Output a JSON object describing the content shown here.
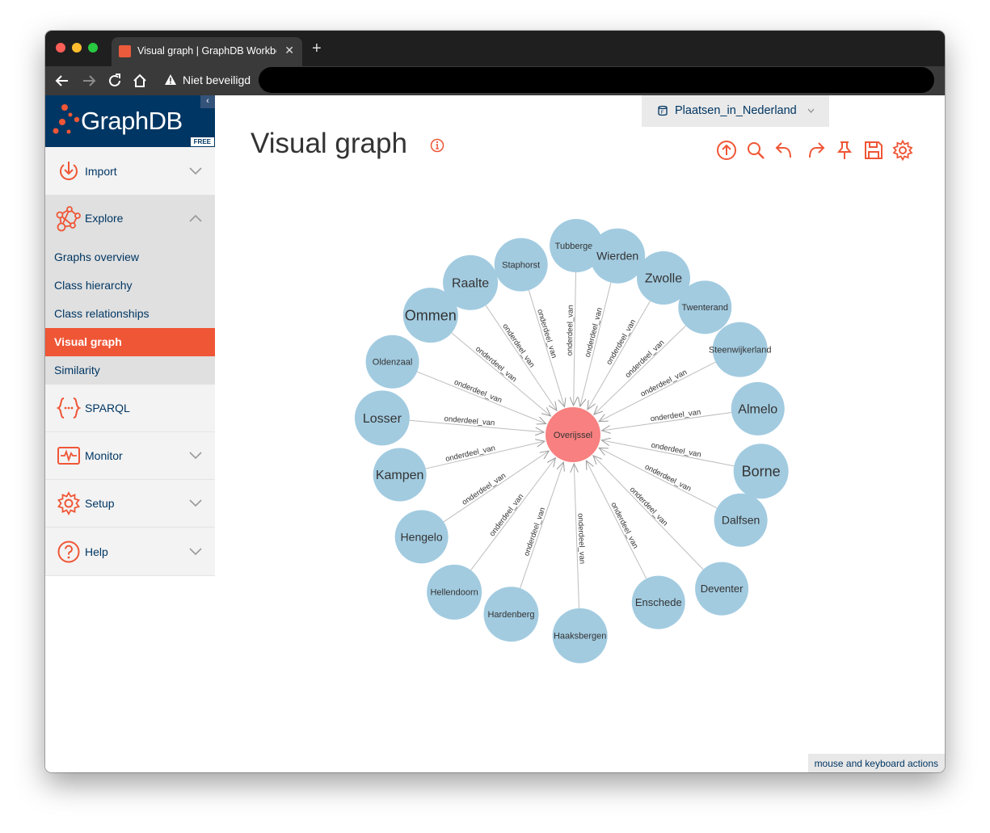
{
  "browser": {
    "tab_title": "Visual graph | GraphDB Workbench",
    "security_label": "Niet beveiligd",
    "url": ""
  },
  "sidebar": {
    "logo_text": "GraphDB",
    "edition_badge": "FREE",
    "collapse_glyph": "‹",
    "items": [
      {
        "label": "Import",
        "icon": "import-icon"
      },
      {
        "label": "Explore",
        "icon": "explore-icon"
      },
      {
        "label": "SPARQL",
        "icon": "sparql-icon"
      },
      {
        "label": "Monitor",
        "icon": "monitor-icon"
      },
      {
        "label": "Setup",
        "icon": "setup-icon"
      },
      {
        "label": "Help",
        "icon": "help-icon"
      }
    ],
    "explore_subitems": [
      {
        "label": "Graphs overview",
        "active": false
      },
      {
        "label": "Class hierarchy",
        "active": false
      },
      {
        "label": "Class relationships",
        "active": false
      },
      {
        "label": "Visual graph",
        "active": true
      },
      {
        "label": "Similarity",
        "active": false
      }
    ]
  },
  "repository": {
    "name": "Plaatsen_in_Nederland"
  },
  "page": {
    "title": "Visual graph"
  },
  "toolbar_icons": [
    "export-icon",
    "search-icon",
    "undo-icon",
    "redo-icon",
    "pin-icon",
    "save-icon",
    "settings-icon"
  ],
  "graph": {
    "center": {
      "label": "Overijssel",
      "color": "#f88080"
    },
    "edge_label": "onderdeel_van",
    "node_color": "#a2cbe0",
    "nodes": [
      "Tubbergen",
      "Wierden",
      "Zwolle",
      "Twenterand",
      "Steenwijkerland",
      "Almelo",
      "Borne",
      "Dalfsen",
      "Deventer",
      "Enschede",
      "Haaksbergen",
      "Hardenberg",
      "Hellendoorn",
      "Hengelo",
      "Kampen",
      "Losser",
      "Oldenzaal",
      "Ommen",
      "Raalte",
      "Staphorst"
    ]
  },
  "footer": {
    "help_link": "mouse and keyboard actions"
  },
  "colors": {
    "accent": "#ef5636",
    "navy": "#003663",
    "edge": "#bdbdbd"
  }
}
